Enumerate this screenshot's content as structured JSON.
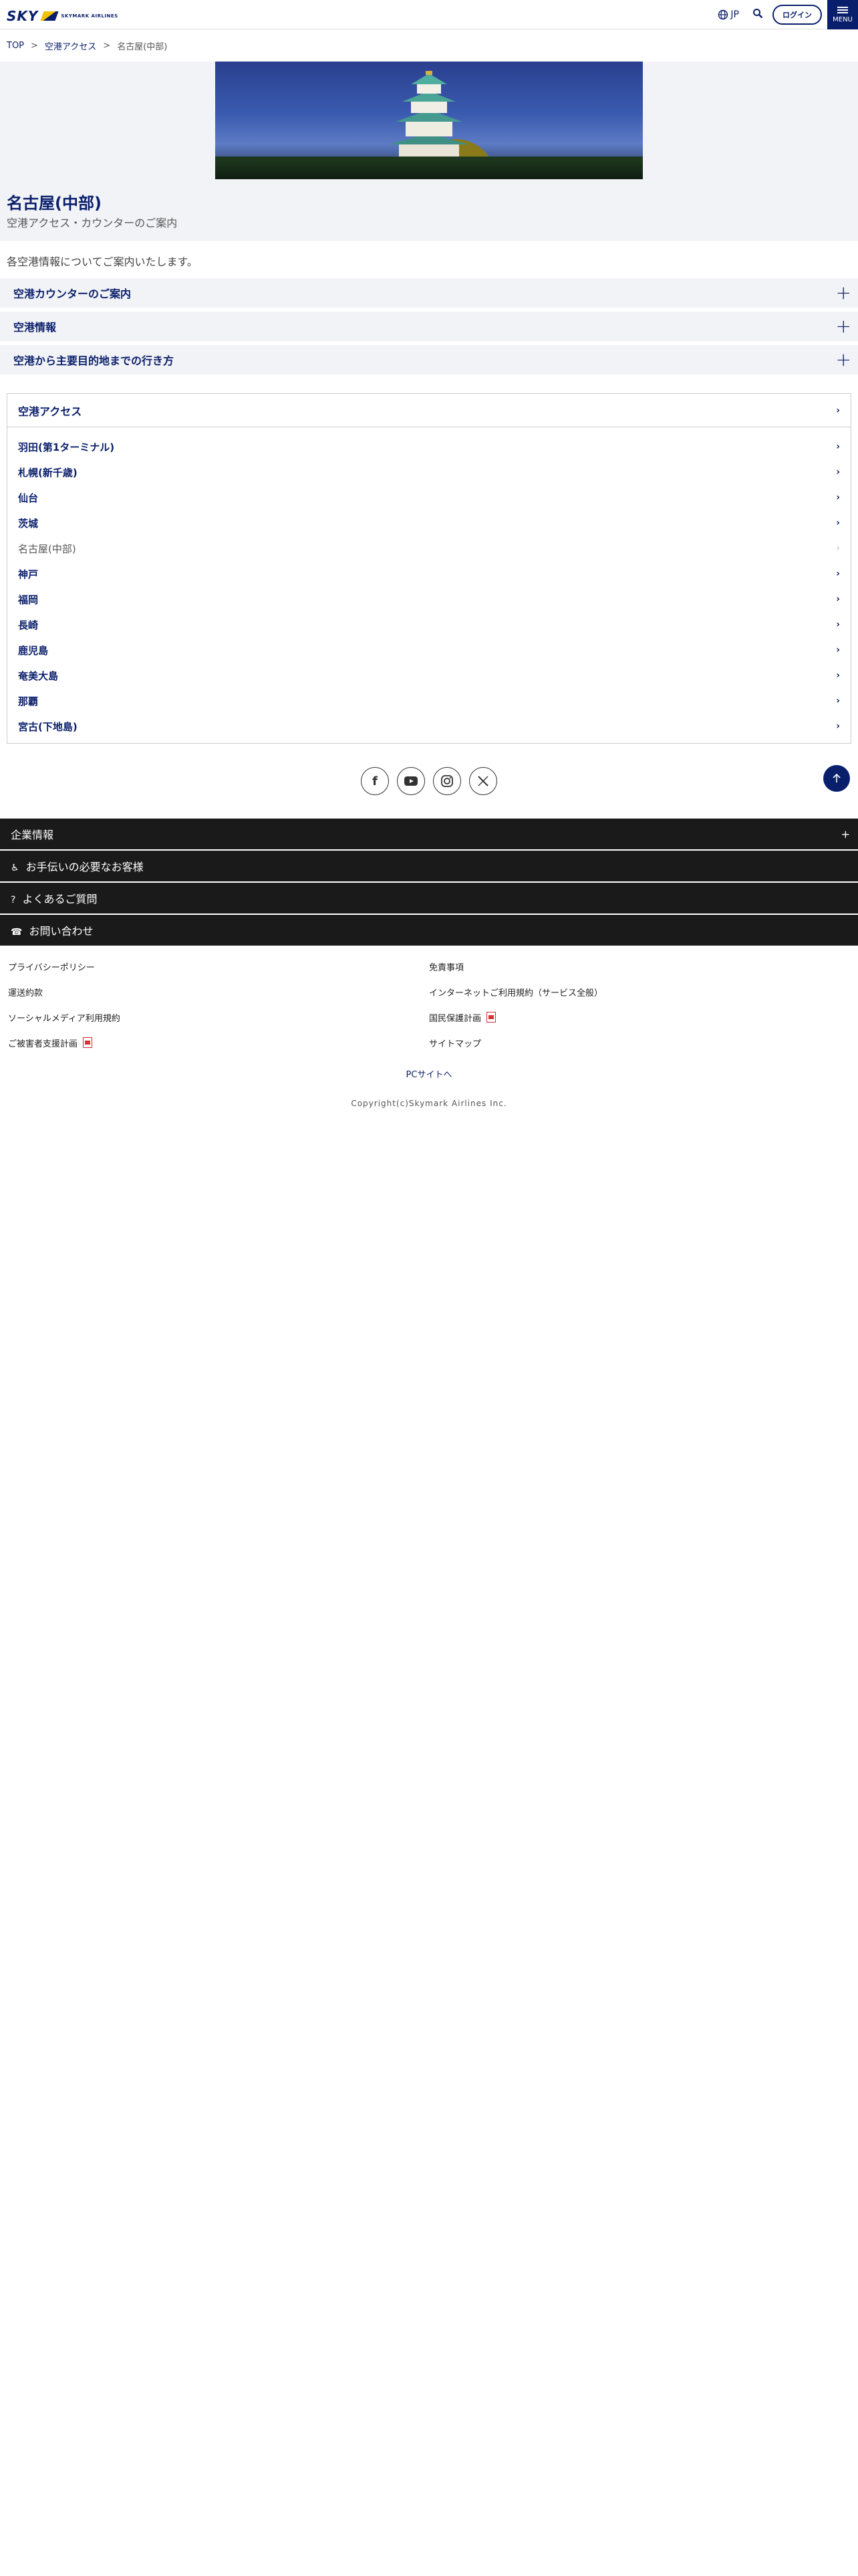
{
  "header": {
    "logo_text": "SKY",
    "brand_text": "SKYMARK AIRLINES",
    "lang": "JP",
    "login": "ログイン",
    "menu": "MENU"
  },
  "breadcrumb": [
    "TOP",
    "空港アクセス",
    "名古屋(中部)"
  ],
  "hero": {
    "title": "名古屋(中部)",
    "subtitle": "空港アクセス・カウンターのご案内"
  },
  "intro": "各空港情報についてご案内いたします。",
  "accordions": [
    "空港カウンターのご案内",
    "空港情報",
    "空港から主要目的地までの行き方"
  ],
  "nav": {
    "heading": "空港アクセス",
    "items": [
      "羽田(第1ターミナル)",
      "札幌(新千歳)",
      "仙台",
      "茨城",
      "名古屋(中部)",
      "神戸",
      "福岡",
      "長崎",
      "鹿児島",
      "奄美大島",
      "那覇",
      "宮古(下地島)"
    ],
    "current_index": 4
  },
  "footer": {
    "bars": [
      "企業情報",
      "お手伝いの必要なお客様",
      "よくあるご質問",
      "お問い合わせ"
    ],
    "links": [
      "プライバシーポリシー",
      "免責事項",
      "運送約款",
      "インターネットご利用規約（サービス全般）",
      "ソーシャルメディア利用規約",
      "国民保護計画",
      "ご被害者支援計画",
      "サイトマップ"
    ],
    "pc_link": "PCサイトへ",
    "copyright": "Copyright(c)Skymark Airlines Inc."
  },
  "colors": {
    "brand": "#0a1f6b",
    "footer_bg": "#1a1a1a",
    "section_bg": "#f2f3f7"
  }
}
